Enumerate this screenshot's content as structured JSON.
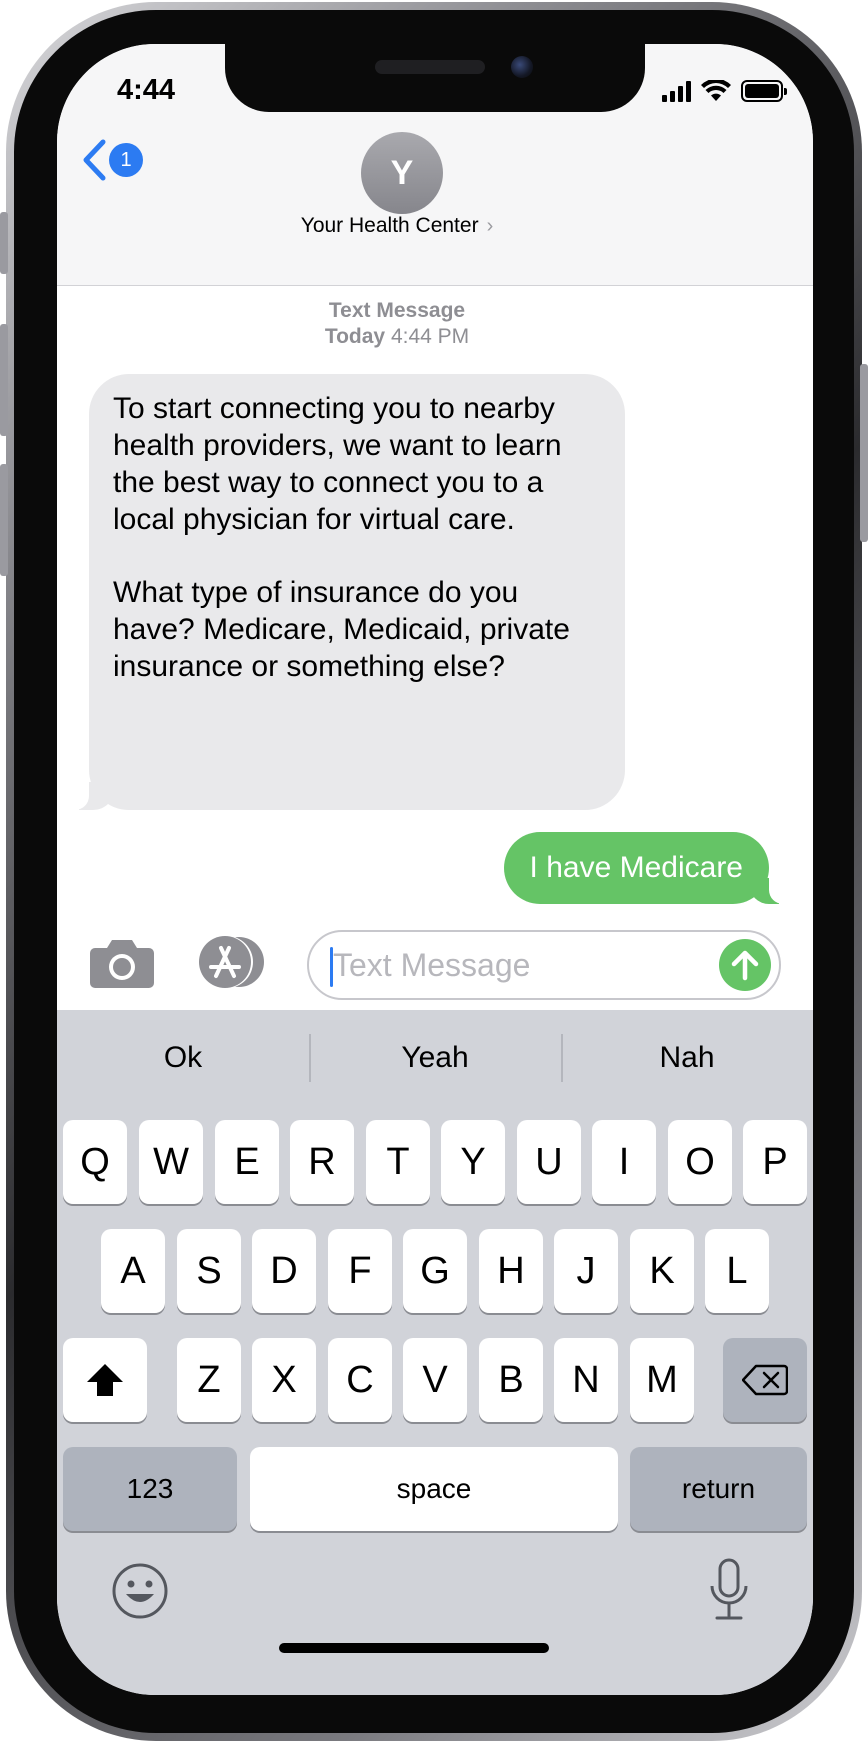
{
  "status_bar": {
    "time": "4:44"
  },
  "header": {
    "back_badge_count": "1",
    "avatar_initial": "Y",
    "contact_name": "Your Health Center",
    "chevron": "›"
  },
  "conversation": {
    "meta_label": "Text Message",
    "meta_day": "Today",
    "meta_time": "4:44 PM",
    "incoming_paragraph_1": "To start connecting you to nearby health providers, we want to learn the best way to connect you to a local physician for virtual care.",
    "incoming_paragraph_2": "What type of insurance do you have? Medicare, Medicaid, private insurance or something else?",
    "outgoing": "I have Medicare"
  },
  "composer": {
    "placeholder": "Text Message",
    "value": ""
  },
  "predictions": [
    "Ok",
    "Yeah",
    "Nah"
  ],
  "keyboard": {
    "row1": [
      "Q",
      "W",
      "E",
      "R",
      "T",
      "Y",
      "U",
      "I",
      "O",
      "P"
    ],
    "row2": [
      "A",
      "S",
      "D",
      "F",
      "G",
      "H",
      "J",
      "K",
      "L"
    ],
    "row3": [
      "Z",
      "X",
      "C",
      "V",
      "B",
      "N",
      "M"
    ],
    "numbers_label": "123",
    "space_label": "space",
    "return_label": "return"
  },
  "icons": {
    "back": "chevron-left-icon",
    "camera": "camera-icon",
    "apps": "app-store-icon",
    "send": "arrow-up-icon",
    "shift": "shift-icon",
    "delete": "delete-icon",
    "emoji": "emoji-icon",
    "mic": "microphone-icon"
  },
  "colors": {
    "ios_blue": "#2c7bf2",
    "imessage_green": "#65c466",
    "incoming_bubble": "#e9e9eb",
    "keyboard_bg": "#d1d3d9"
  }
}
